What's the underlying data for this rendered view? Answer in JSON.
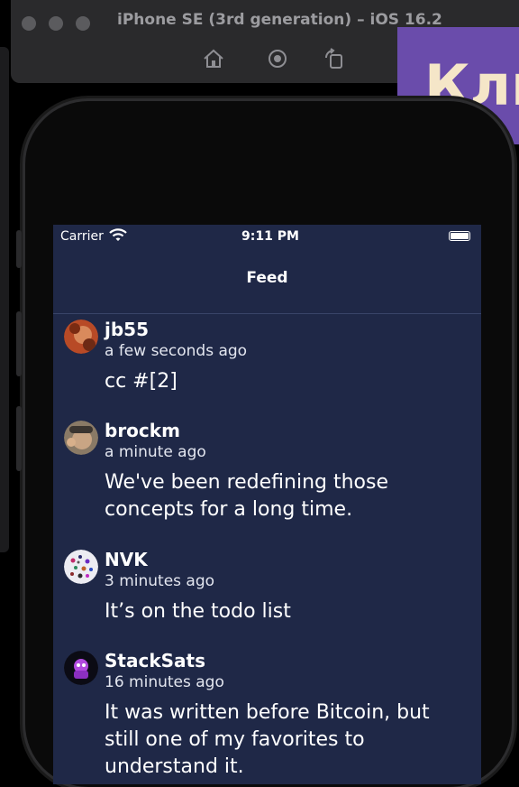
{
  "simulator": {
    "title": "iPhone SE (3rd generation) – iOS 16.2",
    "toolbar_icons": [
      "home-icon",
      "screenshot-icon",
      "rotate-icon"
    ]
  },
  "overlay_banner": {
    "text": "Кли"
  },
  "status_bar": {
    "carrier": "Carrier",
    "time": "9:11 PM"
  },
  "nav": {
    "title": "Feed"
  },
  "feed": [
    {
      "author": "jb55",
      "time_ago": "a few seconds ago",
      "content": "cc #[2]",
      "avatar_color": "#c0572c"
    },
    {
      "author": "brockm",
      "time_ago": "a minute ago",
      "content": "We've been redefining those concepts for a long time.",
      "avatar_color": "#a88e73"
    },
    {
      "author": "NVK",
      "time_ago": "3 minutes ago",
      "content": "It’s on the todo list",
      "avatar_color": "#e8e8ee"
    },
    {
      "author": "StackSats",
      "time_ago": "16 minutes ago",
      "content": "It was written before Bitcoin, but still one of my favorites to understand it.",
      "avatar_color": "#0b0b14"
    }
  ],
  "colors": {
    "screen_bg": "#1f2847",
    "banner_bg": "#6a4cab"
  }
}
